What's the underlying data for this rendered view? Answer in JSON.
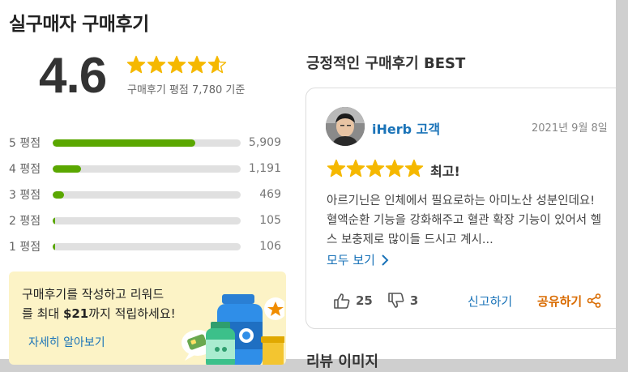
{
  "page_title": "실구매자 구매후기",
  "summary": {
    "rating": "4.6",
    "basis_text": "구매후기 평점 7,780 기준",
    "stars_value": 4.6
  },
  "distribution": [
    {
      "label": "5 평점",
      "count": "5,909",
      "fraction": 0.76
    },
    {
      "label": "4 평점",
      "count": "1,191",
      "fraction": 0.153
    },
    {
      "label": "3 평점",
      "count": "469",
      "fraction": 0.06
    },
    {
      "label": "2 평점",
      "count": "105",
      "fraction": 0.014
    },
    {
      "label": "1 평점",
      "count": "106",
      "fraction": 0.014
    }
  ],
  "promo": {
    "line1": "구매후기를 작성하고 리워드",
    "line2_pre": "를 최대 ",
    "line2_amount": "$21",
    "line2_post": "까지 적립하세요!",
    "link": "자세히 알아보기"
  },
  "best": {
    "title": "긍정적인 구매후기 BEST",
    "reviewer": "iHerb 고객",
    "date": "2021년 9월 8일",
    "stars_value": 5,
    "heading": "최고!",
    "body": "아르기닌은 인체에서 필요로하는 아미노산 성분인데요! 혈액순환 기능을 강화해주고 혈관 확장 기능이 있어서 헬스 보충제로 많이들 드시고 계시...",
    "more_label": "모두 보기",
    "likes": "25",
    "dislikes": "3",
    "report_label": "신고하기",
    "share_label": "공유하기"
  },
  "images_section_title": "리뷰 이미지",
  "colors": {
    "star": "#f5b800",
    "bar": "#5aa700",
    "link": "#1a73b8",
    "share": "#d96b00",
    "promo_bg": "#fcf3c6"
  }
}
